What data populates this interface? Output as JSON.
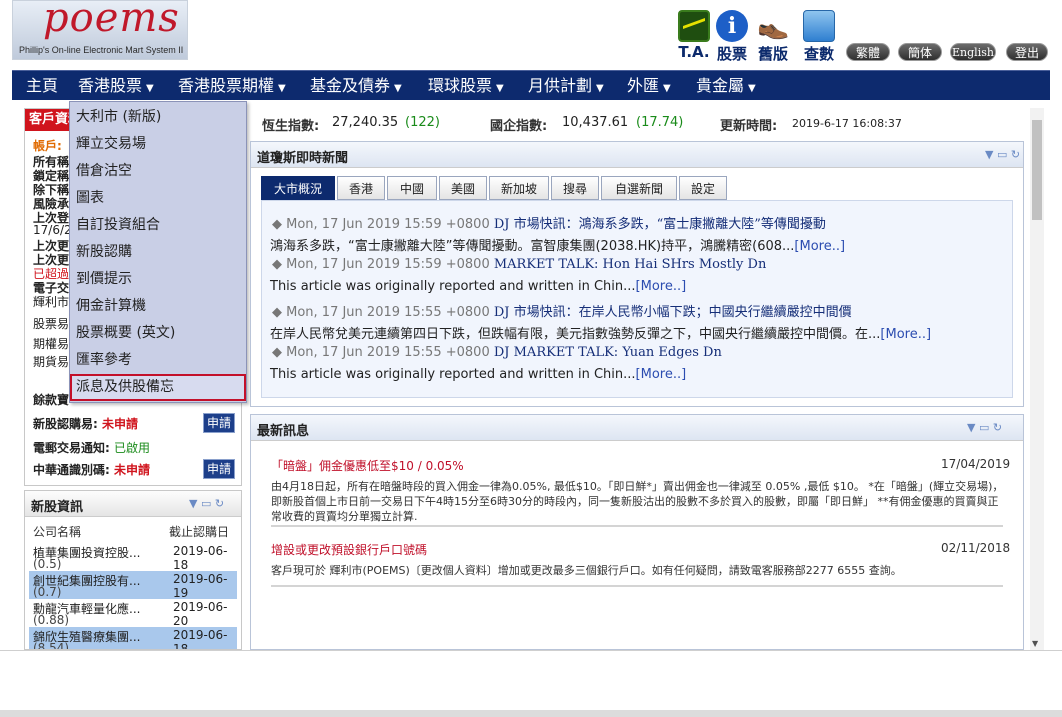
{
  "header": {
    "logo_text": "poems",
    "logo_tagline": "Phillip's On-line Electronic Mart System II",
    "tools": {
      "ta": "T.A.",
      "stock": "股票",
      "old": "舊版",
      "query": "查數"
    },
    "stock_icon_glyph": "i",
    "old_icon_glyph": "👞",
    "pills": {
      "trad": "繁體",
      "simp": "簡体",
      "eng": "English",
      "logout": "登出"
    }
  },
  "nav": {
    "items": [
      {
        "label": "主頁",
        "has_caret": false
      },
      {
        "label": "香港股票",
        "has_caret": true
      },
      {
        "label": "香港股票期權",
        "has_caret": true
      },
      {
        "label": "基金及債券",
        "has_caret": true
      },
      {
        "label": "環球股票",
        "has_caret": true
      },
      {
        "label": "月供計劃",
        "has_caret": true
      },
      {
        "label": "外匯",
        "has_caret": true
      },
      {
        "label": "貴金屬",
        "has_caret": true
      }
    ],
    "caret": "▼"
  },
  "quotes": {
    "hsi_label": "恆生指數:",
    "hsi_value": "27,240.35",
    "hsi_change": "(122)",
    "hscei_label": "國企指數:",
    "hscei_value": "10,437.61",
    "hscei_change": "(17.74)",
    "update_label": "更新時間:",
    "update_value": "2019-6-17 16:08:37"
  },
  "client": {
    "head": "客戶資料",
    "account_label": "帳戶:",
    "rows": [
      "所有稱",
      "鎖定稱",
      "除下稱",
      "風險承",
      "上次登",
      "17/6/2",
      "上次更",
      "上次更",
      "已超過",
      "電子交",
      "輝利市",
      "股票易",
      "期權易",
      "期貨易"
    ],
    "funds_label": "餘款寶",
    "ipo_label": "新股認購易:",
    "ipo_status": "未申請",
    "etn_label": "電郵交易通知:",
    "etn_status": "已啟用",
    "chinaconnect_label": "中華通識別碼:",
    "chinaconnect_status": "未申請",
    "apply_label": "申請"
  },
  "dropdown": {
    "items": [
      "大利市 (新版)",
      "輝立交易場",
      "借倉沽空",
      "圖表",
      "自訂投資組合",
      "新股認購",
      "到價提示",
      "佣金計算機",
      "股票概要 (英文)",
      "匯率參考",
      "派息及供股備忘"
    ],
    "active_index": 10
  },
  "newshare": {
    "title": "新股資訊",
    "col_name": "公司名稱",
    "col_date": "截止認購日",
    "rows": [
      {
        "name": "植華集團投資控股...",
        "num": "(0.5)",
        "date": "2019-06-18",
        "highlight": false
      },
      {
        "name": "創世紀集團控股有...",
        "num": "(0.7)",
        "date": "2019-06-19",
        "highlight": true
      },
      {
        "name": "勳龍汽車輕量化應...",
        "num": "(0.88)",
        "date": "2019-06-20",
        "highlight": false
      },
      {
        "name": "錦欣生殖醫療集團...",
        "num": "(8.54)",
        "date": "2019-06-18",
        "highlight": true
      }
    ]
  },
  "news": {
    "title": "道瓊斯即時新聞",
    "tabs": [
      "大市概況",
      "香港",
      "中國",
      "美國",
      "新加坡",
      "搜尋",
      "自選新聞",
      "設定"
    ],
    "active_tab": 0,
    "more_label": "[More..]",
    "items": [
      {
        "stamp": "◆ Mon, 17 Jun 2019 15:59 +0800",
        "title": "DJ 市場快訊：鴻海系多跌，“富士康撇離大陸”等傳聞擾動",
        "desc": "鴻海系多跌，“富士康撇離大陸”等傳聞擾動。富智康集團(2038.HK)持平，鴻騰精密(608..."
      },
      {
        "stamp": "◆ Mon, 17 Jun 2019 15:59 +0800",
        "title": "MARKET TALK: Hon Hai SHrs Mostly Dn",
        "desc": "This article was originally reported and written in Chin..."
      },
      {
        "stamp": "◆ Mon, 17 Jun 2019 15:55 +0800",
        "title": "DJ 市場快訊：在岸人民幣小幅下跌；中國央行繼續嚴控中間價",
        "desc": "在岸人民幣兌美元連續第四日下跌，但跌幅有限，美元指數強勢反彈之下，中國央行繼續嚴控中間價。在..."
      },
      {
        "stamp": "◆ Mon, 17 Jun 2019 15:55 +0800",
        "title": "DJ MARKET TALK: Yuan Edges Dn",
        "desc": "This article was originally reported and written in Chin..."
      }
    ]
  },
  "latest": {
    "title": "最新訊息",
    "items": [
      {
        "title": "「暗盤」佣金優惠低至$10 / 0.05%",
        "date": "17/04/2019",
        "body": "由4月18日起，所有在暗盤時段的買入佣金一律為0.05%, 最低$10。「即日鮮*」賣出佣金也一律減至 0.05% ,最低 $10。 *在「暗盤」(輝立交易場)，即新股首個上市日前一交易日下午4時15分至6時30分的時段內，同一隻新股沽出的股數不多於買入的股數，即屬「即日鮮」 **有佣金優惠的買賣與正常收費的買賣均分單獨立計算."
      },
      {
        "title": "增設或更改預設銀行戶口號碼",
        "date": "02/11/2018",
        "body": "客戶現可於 輝利市(POEMS)〔更改個人資料〕增加或更改最多三個銀行戶口。如有任何疑問，請致電客服務部2277 6555 查詢。"
      }
    ]
  },
  "panel_controls": "▼ ▭ ↻",
  "colors": {
    "nav_bg": "#0d2a6e",
    "brand_red": "#c3102a",
    "change_green": "#1a8b1a",
    "link_blue": "#2b4cb0"
  }
}
